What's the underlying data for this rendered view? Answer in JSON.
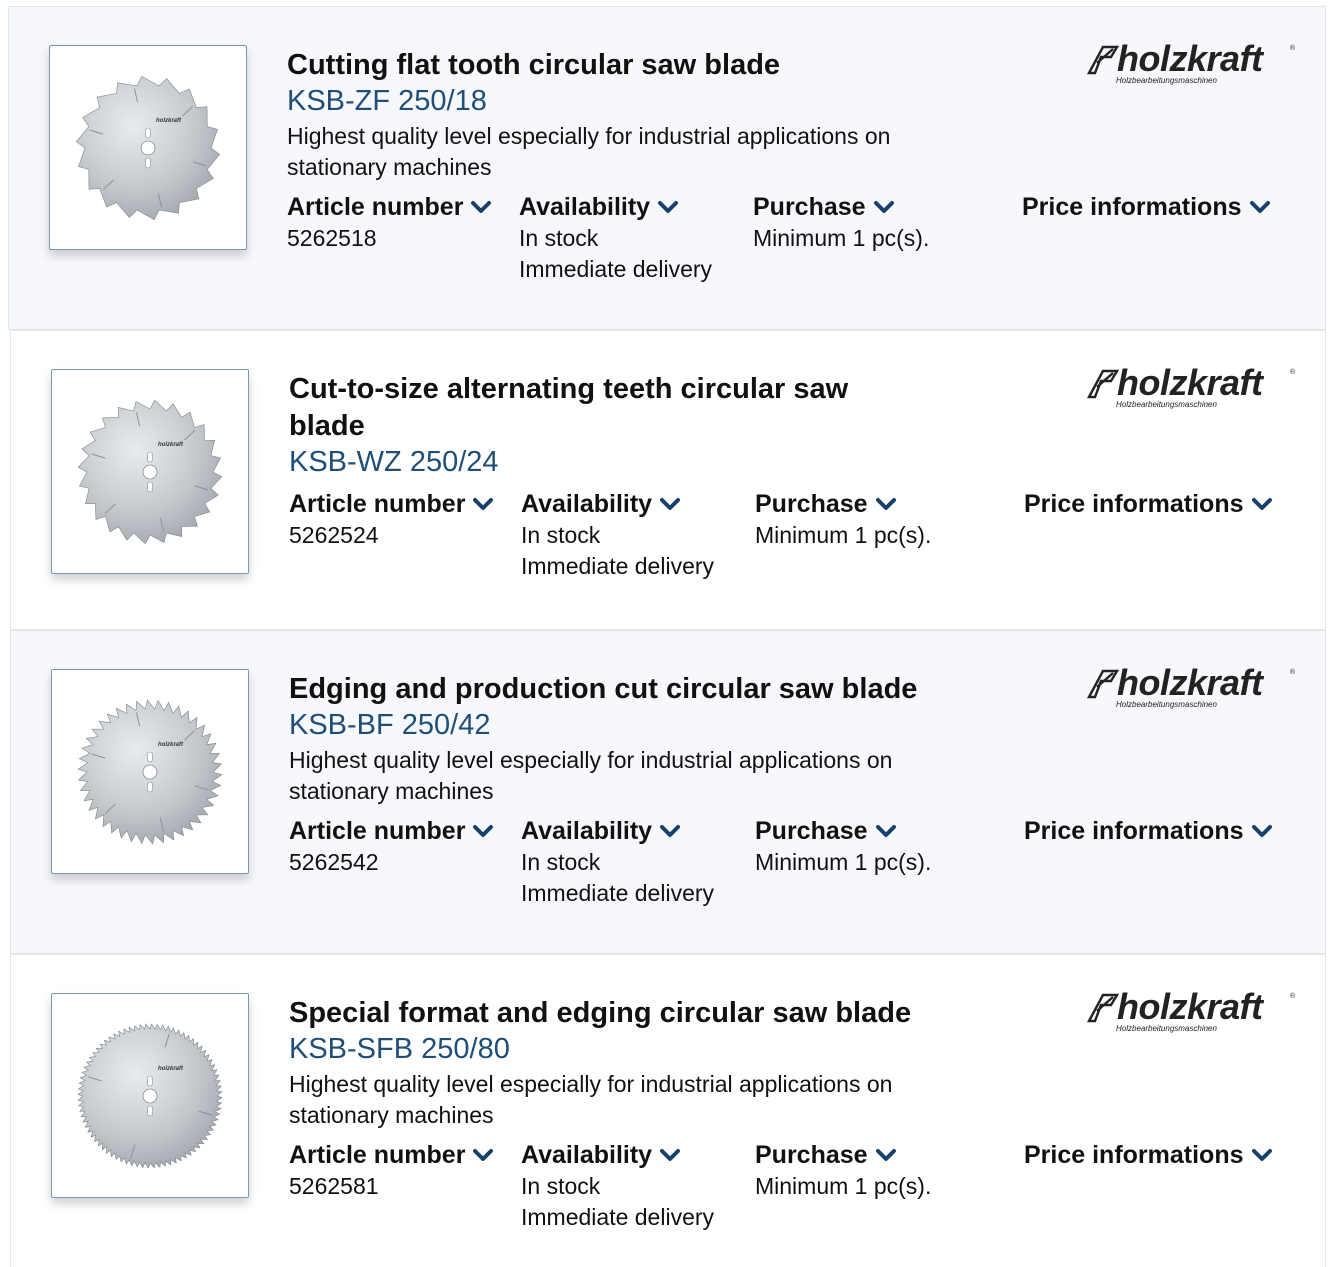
{
  "products": [
    {
      "title": "Cutting flat tooth circular saw blade",
      "model": "KSB-ZF 250/18",
      "description": "Highest quality level especially for industrial applications on stationary machines",
      "brand": {
        "name": "holzkraft",
        "tagline": "Holzbearbeitungsmaschinen",
        "registered": "®"
      },
      "columns": {
        "article": {
          "label": "Article number",
          "values": [
            "5262518"
          ]
        },
        "availability": {
          "label": "Availability",
          "values": [
            "In stock",
            "Immediate delivery"
          ]
        },
        "purchase": {
          "label": "Purchase",
          "values": [
            "Minimum 1 pc(s)."
          ]
        },
        "price": {
          "label": "Price informations",
          "values": []
        }
      }
    },
    {
      "title": "Cut-to-size alternating teeth circular saw blade",
      "model": "KSB-WZ 250/24",
      "description": "",
      "brand": {
        "name": "holzkraft",
        "tagline": "Holzbearbeitungsmaschinen",
        "registered": "®"
      },
      "columns": {
        "article": {
          "label": "Article number",
          "values": [
            "5262524"
          ]
        },
        "availability": {
          "label": "Availability",
          "values": [
            "In stock",
            "Immediate delivery"
          ]
        },
        "purchase": {
          "label": "Purchase",
          "values": [
            "Minimum 1 pc(s)."
          ]
        },
        "price": {
          "label": "Price informations",
          "values": []
        }
      }
    },
    {
      "title": "Edging and production cut circular saw blade",
      "model": "KSB-BF 250/42",
      "description": "Highest quality level especially for industrial applications on stationary machines",
      "brand": {
        "name": "holzkraft",
        "tagline": "Holzbearbeitungsmaschinen",
        "registered": "®"
      },
      "columns": {
        "article": {
          "label": "Article number",
          "values": [
            "5262542"
          ]
        },
        "availability": {
          "label": "Availability",
          "values": [
            "In stock",
            "Immediate delivery"
          ]
        },
        "purchase": {
          "label": "Purchase",
          "values": [
            "Minimum 1 pc(s)."
          ]
        },
        "price": {
          "label": "Price informations",
          "values": []
        }
      }
    },
    {
      "title": "Special format and edging circular saw blade",
      "model": "KSB-SFB 250/80",
      "description": "Highest quality level especially for industrial applications on stationary machines",
      "brand": {
        "name": "holzkraft",
        "tagline": "Holzbearbeitungsmaschinen",
        "registered": "®"
      },
      "columns": {
        "article": {
          "label": "Article number",
          "values": [
            "5262581"
          ]
        },
        "availability": {
          "label": "Availability",
          "values": [
            "In stock",
            "Immediate delivery"
          ]
        },
        "purchase": {
          "label": "Purchase",
          "values": [
            "Minimum 1 pc(s)."
          ]
        },
        "price": {
          "label": "Price informations",
          "values": []
        }
      }
    }
  ],
  "thumbnail_brand_text": "holzkraft",
  "icons": {
    "expand": "chevron-down-icon",
    "brand_mark": "holzkraft-logo-icon"
  },
  "colors": {
    "accent": "#1f4e79",
    "chevron": "#17406b",
    "card_bg": "#f6f8fb",
    "border": "#e3e7ec"
  }
}
